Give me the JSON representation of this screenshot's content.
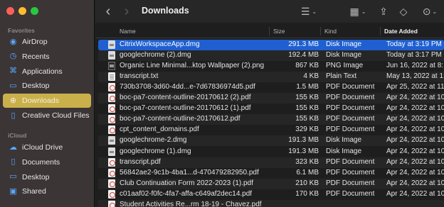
{
  "window_title": "Downloads",
  "sidebar": {
    "favorites_title": "Favorites",
    "favorites": [
      {
        "label": "AirDrop",
        "icon": "airdrop-icon",
        "glyph": "◉"
      },
      {
        "label": "Recents",
        "icon": "clock-icon",
        "glyph": "◷"
      },
      {
        "label": "Applications",
        "icon": "applications-icon",
        "glyph": "⌘"
      },
      {
        "label": "Desktop",
        "icon": "desktop-icon",
        "glyph": "▭"
      },
      {
        "label": "Downloads",
        "icon": "downloads-icon",
        "glyph": "⊕",
        "selected": true
      },
      {
        "label": "Creative Cloud Files",
        "icon": "document-icon",
        "glyph": "▯"
      }
    ],
    "icloud_title": "iCloud",
    "icloud": [
      {
        "label": "iCloud Drive",
        "icon": "cloud-icon",
        "glyph": "☁"
      },
      {
        "label": "Documents",
        "icon": "document-icon",
        "glyph": "▯"
      },
      {
        "label": "Desktop",
        "icon": "desktop-icon",
        "glyph": "▭"
      },
      {
        "label": "Shared",
        "icon": "shared-folder-icon",
        "glyph": "▣"
      }
    ]
  },
  "toolbar": {
    "back_glyph": "‹",
    "forward_glyph": "›",
    "list_view_glyph": "☰",
    "gallery_glyph": "▦",
    "share_glyph": "⇪",
    "tag_glyph": "◇",
    "more_glyph": "⊙"
  },
  "columns": {
    "name": "Name",
    "size": "Size",
    "kind": "Kind",
    "date_added": "Date Added"
  },
  "files": [
    {
      "name": "CitrixWorkspaceApp.dmg",
      "size": "291.3 MB",
      "kind": "Disk Image",
      "date": "Today at 3:19 PM",
      "type": "dmg",
      "selected": true
    },
    {
      "name": "googlechrome (2).dmg",
      "size": "192.4 MB",
      "kind": "Disk Image",
      "date": "Today at 3:17 PM",
      "type": "dmg"
    },
    {
      "name": "Organic Line Minimal...ktop Wallpaper (2).png",
      "size": "867 KB",
      "kind": "PNG Image",
      "date": "Jun 16, 2022 at 8:",
      "type": "png"
    },
    {
      "name": "transcript.txt",
      "size": "4 KB",
      "kind": "Plain Text",
      "date": "May 13, 2022 at 1:",
      "type": "txt"
    },
    {
      "name": "730b3708-3d60-4dd...e-7d67836974d5.pdf",
      "size": "1.5 MB",
      "kind": "PDF Document",
      "date": "Apr 25, 2022 at 11:",
      "type": "pdf"
    },
    {
      "name": "boc-pa7-content-outline-20170612 (2).pdf",
      "size": "155 KB",
      "kind": "PDF Document",
      "date": "Apr 24, 2022 at 10:",
      "type": "pdf"
    },
    {
      "name": "boc-pa7-content-outline-20170612 (1).pdf",
      "size": "155 KB",
      "kind": "PDF Document",
      "date": "Apr 24, 2022 at 10:",
      "type": "pdf"
    },
    {
      "name": "boc-pa7-content-outline-20170612.pdf",
      "size": "155 KB",
      "kind": "PDF Document",
      "date": "Apr 24, 2022 at 10:",
      "type": "pdf"
    },
    {
      "name": "cpt_content_domains.pdf",
      "size": "329 KB",
      "kind": "PDF Document",
      "date": "Apr 24, 2022 at 10:",
      "type": "pdf"
    },
    {
      "name": "googlechrome-2.dmg",
      "size": "191.3 MB",
      "kind": "Disk Image",
      "date": "Apr 24, 2022 at 10:",
      "type": "dmg"
    },
    {
      "name": "googlechrome (1).dmg",
      "size": "191.3 MB",
      "kind": "Disk Image",
      "date": "Apr 24, 2022 at 10:",
      "type": "dmg"
    },
    {
      "name": "transcript.pdf",
      "size": "323 KB",
      "kind": "PDF Document",
      "date": "Apr 24, 2022 at 10:",
      "type": "pdf"
    },
    {
      "name": "56842ae2-9c1b-4ba1...d-470479282950.pdf",
      "size": "6.1 MB",
      "kind": "PDF Document",
      "date": "Apr 24, 2022 at 10:",
      "type": "pdf"
    },
    {
      "name": "Club Continuation Form 2022-2023 (1).pdf",
      "size": "210 KB",
      "kind": "PDF Document",
      "date": "Apr 24, 2022 at 10:",
      "type": "pdf"
    },
    {
      "name": "c01aaf02-f0fc-4fa7-affa-c649af2dec14.pdf",
      "size": "170 KB",
      "kind": "PDF Document",
      "date": "Apr 24, 2022 at 10:",
      "type": "pdf"
    },
    {
      "name": "Student Activities Re...rm 18-19 - Chavez.pdf",
      "size": "",
      "kind": "",
      "date": "",
      "type": "pdf"
    }
  ]
}
